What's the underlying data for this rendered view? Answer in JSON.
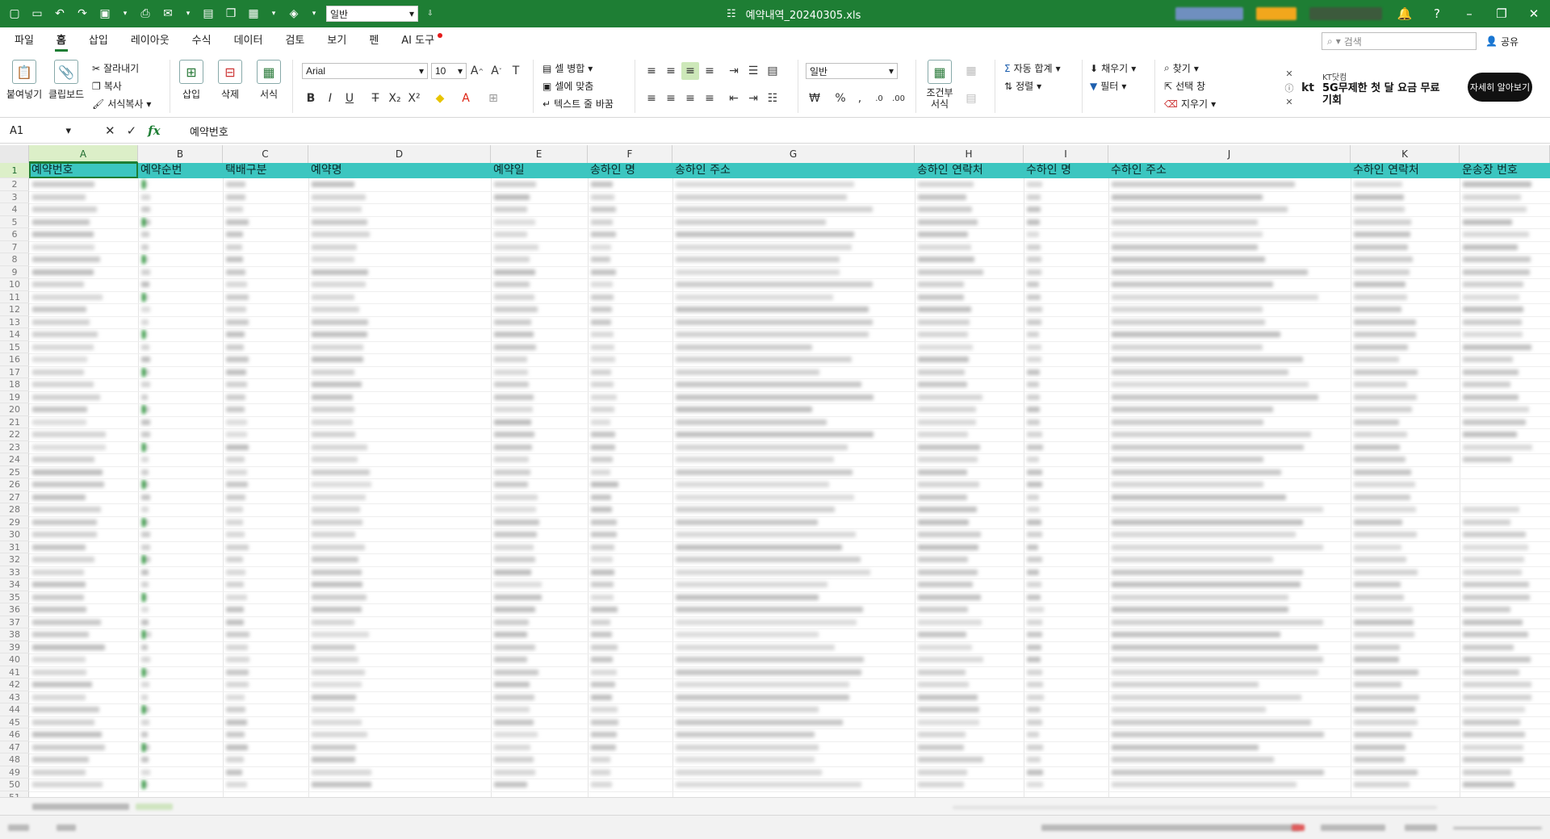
{
  "window": {
    "title": "예약내역_20240305.xls",
    "style_select": "일반",
    "accent_color": "#1e7e34"
  },
  "tabs": [
    "파일",
    "홈",
    "삽입",
    "레이아웃",
    "수식",
    "데이터",
    "검토",
    "보기",
    "펜",
    "AI 도구"
  ],
  "search": {
    "placeholder": "검색"
  },
  "share_label": "공유",
  "ribbon": {
    "paste": "붙여넣기",
    "clipboard": "클립보드",
    "cut": "잘라내기",
    "copy": "복사",
    "format_painter": "서식복사",
    "insert": "삽입",
    "delete": "삭제",
    "format": "서식",
    "font_name": "Arial",
    "font_size": "10",
    "merge": "셀 병합",
    "fit_cell": "셀에 맞춤",
    "wrap_text": "텍스트 줄 바꿈",
    "number_format": "일반",
    "conditional_format": "조건부 서식",
    "autosum": "자동 합계",
    "sort": "정렬",
    "fill": "채우기",
    "filter": "필터",
    "find": "찾기",
    "select_window": "선택 창",
    "clear": "지우기"
  },
  "ad": {
    "brand": "kt",
    "small": "KT닷컴",
    "line1": "5G무제한 첫 달 요금 무료",
    "line2": "기회",
    "button": "자세히 알아보기"
  },
  "formula": {
    "cell_ref": "A1",
    "content": "예약번호"
  },
  "columns": [
    "A",
    "B",
    "C",
    "D",
    "E",
    "F",
    "G",
    "H",
    "I",
    "J",
    "K"
  ],
  "headers": [
    "예약번호",
    "예약순번",
    "택배구분",
    "예약명",
    "예약일",
    "송하인 명",
    "송하인 주소",
    "송하인 연락처",
    "수하인 명",
    "수하인 주소",
    "수하인 연락처",
    "운송장 번호"
  ],
  "row_numbers": [
    "1",
    "2",
    "3",
    "4",
    "5",
    "6",
    "7",
    "8",
    "9",
    "10",
    "11",
    "12",
    "13",
    "14",
    "15",
    "16",
    "17",
    "18",
    "19",
    "20",
    "21",
    "22",
    "23",
    "24",
    "25",
    "26",
    "27",
    "28",
    "29",
    "30",
    "31",
    "32",
    "33",
    "34",
    "35",
    "36",
    "37",
    "38",
    "39",
    "40",
    "41",
    "42",
    "43",
    "44",
    "45",
    "46",
    "47",
    "48",
    "49",
    "50",
    "51"
  ],
  "header_row_color": "#3cc6c0"
}
